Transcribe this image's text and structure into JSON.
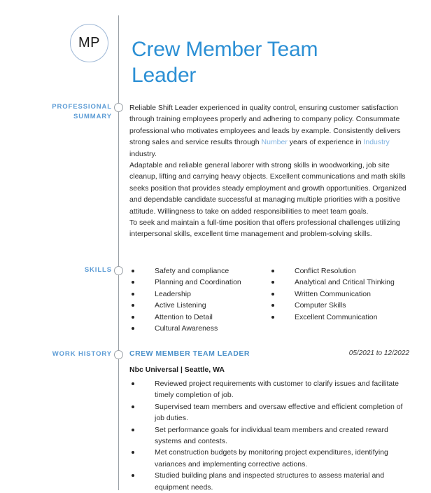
{
  "header": {
    "monogram": "MP",
    "headline": "Crew Member Team Leader",
    "accent_color": "#2b8fd4",
    "label_color": "#5b9bd5"
  },
  "sections": {
    "summary": {
      "label": "Professional Summary",
      "paragraphs": [
        {
          "parts": [
            {
              "text": "Reliable Shift Leader experienced in quality control, ensuring customer satisfaction through training employees properly and adhering to company policy. Consummate professional who motivates employees and leads by example. Consistently delivers strong sales and service results through ",
              "placeholder": false
            },
            {
              "text": "Number",
              "placeholder": true
            },
            {
              "text": " years of experience in ",
              "placeholder": false
            },
            {
              "text": "Industry",
              "placeholder": true
            },
            {
              "text": " industry.",
              "placeholder": false
            }
          ]
        },
        {
          "parts": [
            {
              "text": "Adaptable and reliable general laborer with strong skills in woodworking, job site cleanup, lifting and carrying heavy objects. Excellent communications and math skills seeks position that provides steady employment and growth opportunities. Organized and dependable candidate successful at managing multiple priorities with a positive attitude. Willingness to take on added responsibilities to meet team goals.",
              "placeholder": false
            }
          ]
        },
        {
          "parts": [
            {
              "text": "To seek and maintain a full-time position that offers professional challenges utilizing interpersonal skills, excellent time management and problem-solving skills.",
              "placeholder": false
            }
          ]
        }
      ]
    },
    "skills": {
      "label": "Skills",
      "column_left": [
        "Safety and compliance",
        "Planning and Coordination",
        "Leadership",
        "Active Listening",
        "Attention to Detail",
        "Cultural Awareness"
      ],
      "column_right": [
        "Conflict Resolution",
        "Analytical and Critical Thinking",
        "Written Communication",
        "Computer Skills",
        "Excellent Communication"
      ]
    },
    "work_history": {
      "label": "Work History",
      "jobs": [
        {
          "title": "Crew Member Team Leader",
          "dates": "05/2021 to 12/2022",
          "company": "Nbc Universal | Seattle, WA",
          "duties": [
            "Reviewed project requirements with customer to clarify issues and facilitate timely completion of job.",
            "Supervised team members and oversaw effective and efficient completion of job duties.",
            "Set performance goals for individual team members and created reward systems and contests.",
            "Met construction budgets by monitoring project expenditures, identifying variances and implementing corrective actions.",
            "Studied building plans and inspected structures to assess material and equipment needs."
          ]
        }
      ]
    }
  }
}
